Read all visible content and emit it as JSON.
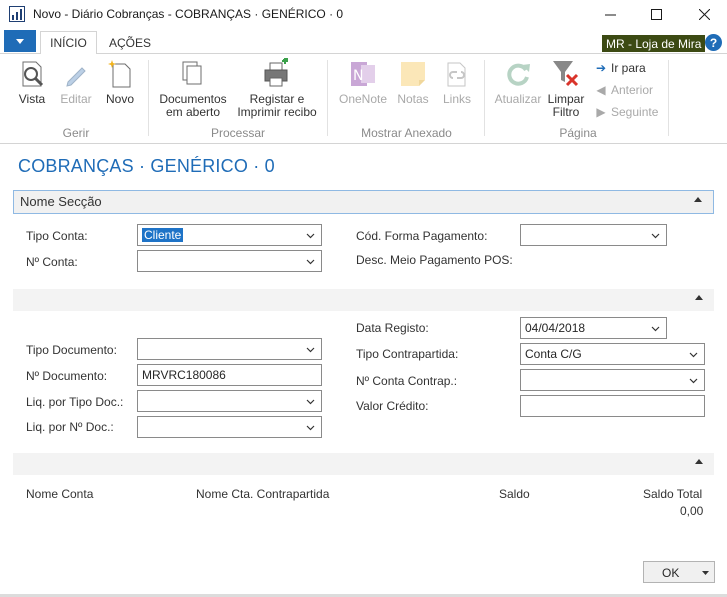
{
  "window": {
    "title": "Novo - Diário Cobranças - COBRANÇAS · GENÉRICO · 0"
  },
  "tabs": [
    {
      "label": "INÍCIO",
      "active": true
    },
    {
      "label": "AÇÕES",
      "active": false
    }
  ],
  "company": "MR - Loja de Mira",
  "ribbon": {
    "gerir": {
      "label": "Gerir",
      "vista": "Vista",
      "editar": "Editar",
      "novo": "Novo"
    },
    "processar": {
      "label": "Processar",
      "documentos_l1": "Documentos",
      "documentos_l2": "em aberto",
      "registar_l1": "Registar e",
      "registar_l2": "Imprimir recibo"
    },
    "anexado": {
      "label": "Mostrar Anexado",
      "onenote": "OneNote",
      "notas": "Notas",
      "links": "Links"
    },
    "pagina": {
      "label": "Página",
      "atualizar": "Atualizar",
      "limpar_l1": "Limpar",
      "limpar_l2": "Filtro",
      "ir_para": "Ir para",
      "anterior": "Anterior",
      "seguinte": "Seguinte"
    }
  },
  "page_title": "COBRANÇAS · GENÉRICO · 0",
  "section1": {
    "title": "Nome Secção",
    "tipo_conta_label": "Tipo Conta:",
    "tipo_conta_value": "Cliente",
    "no_conta_label": "Nº Conta:",
    "no_conta_value": "",
    "cod_forma_label": "Cód. Forma Pagamento:",
    "cod_forma_value": "",
    "desc_meio_label": "Desc. Meio Pagamento POS:"
  },
  "section2": {
    "data_registo_label": "Data Registo:",
    "data_registo_value": "04/04/2018",
    "tipo_documento_label": "Tipo Documento:",
    "tipo_documento_value": "",
    "tipo_contrapartida_label": "Tipo Contrapartida:",
    "tipo_contrapartida_value": "Conta C/G",
    "no_documento_label": "Nº Documento:",
    "no_documento_value": "MRVRC180086",
    "no_conta_contrap_label": "Nº Conta Contrap.:",
    "no_conta_contrap_value": "",
    "liq_tipo_doc_label": "Liq. por Tipo Doc.:",
    "liq_tipo_doc_value": "",
    "valor_credito_label": "Valor Crédito:",
    "valor_credito_value": "",
    "liq_no_doc_label": "Liq. por Nº Doc.:",
    "liq_no_doc_value": ""
  },
  "section3": {
    "nome_conta": "Nome Conta",
    "nome_cta_contrapartida": "Nome Cta. Contrapartida",
    "saldo": "Saldo",
    "saldo_total": "Saldo Total",
    "saldo_total_value": "0,00"
  },
  "ok_label": "OK",
  "colors": {
    "accent": "#1f6cb7",
    "company_bg": "#3c4a13",
    "selection": "#1e73c7"
  }
}
